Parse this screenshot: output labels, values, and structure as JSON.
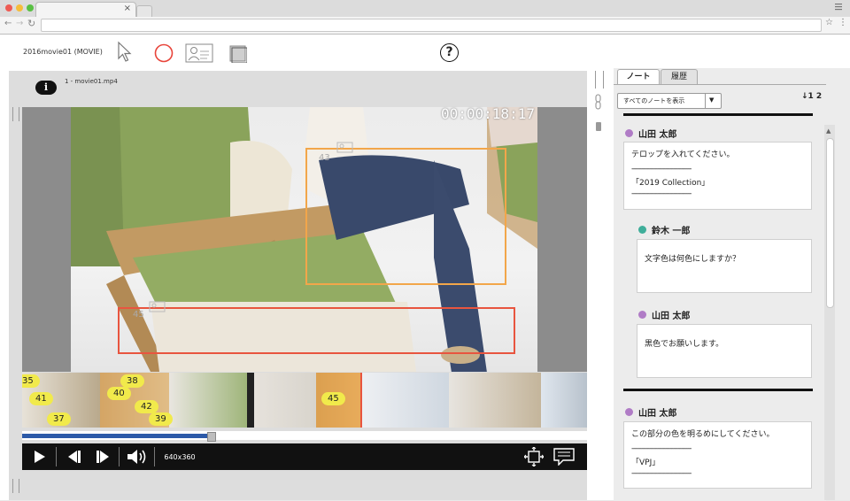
{
  "app": {
    "title": "2016movie01 (MOVIE)",
    "file_label": "1 - movie01.mp4",
    "help_label": "?"
  },
  "video": {
    "timecode": "00:00:18:17",
    "resolution": "640x360",
    "progress": 0.33,
    "annotations": [
      {
        "id": "43",
        "color": "#f2a64a"
      },
      {
        "id": "45",
        "color": "#e8553f"
      }
    ]
  },
  "timeline": {
    "markers": [
      "35",
      "38",
      "40",
      "41",
      "42",
      "37",
      "39",
      "45"
    ]
  },
  "notes_panel": {
    "tabs": [
      "ノート",
      "履歴"
    ],
    "filter": "すべてのノートを表示",
    "filter_arrow": "▼",
    "sort_label": "↓1 2",
    "notes": [
      {
        "author": "山田 太郎",
        "color": "#b07cc6",
        "lines": [
          "テロップを入れてください。",
          "------------------------------",
          "「2019 Collection」",
          "------------------------------"
        ]
      },
      {
        "author": "鈴木 一郎",
        "color": "#3fae9a",
        "lines": [
          "文字色は何色にしますか？"
        ]
      },
      {
        "author": "山田 太郎",
        "color": "#b07cc6",
        "lines": [
          "黒色でお願いします。"
        ]
      },
      {
        "author": "山田 太郎",
        "color": "#b07cc6",
        "lines": [
          "この部分の色を明るめにしてください。",
          "------------------------------",
          "「VPJ」",
          "------------------------------"
        ]
      }
    ]
  }
}
